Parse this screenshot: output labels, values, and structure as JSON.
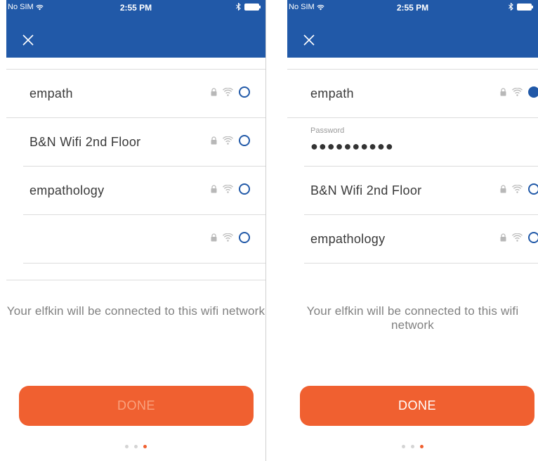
{
  "colors": {
    "header_blue": "#2159a8",
    "accent_orange": "#f06030",
    "divider": "#dcdcdc"
  },
  "left_screen": {
    "statusbar": {
      "carrier": "No SIM",
      "time": "2:55 PM"
    },
    "networks": [
      {
        "name": "empath",
        "secured": true,
        "selected": false
      },
      {
        "name": "B&N Wifi 2nd Floor",
        "secured": true,
        "selected": false
      },
      {
        "name": "empathology",
        "secured": true,
        "selected": false
      },
      {
        "name": "",
        "secured": true,
        "selected": false
      }
    ],
    "message": "Your elfkin will be connected to this wifi network",
    "done_label": "DONE",
    "done_enabled": false,
    "page_indicator": {
      "pages": 3,
      "current": 3
    }
  },
  "right_screen": {
    "statusbar": {
      "carrier": "No SIM",
      "time": "2:55 PM"
    },
    "networks": [
      {
        "name": "empath",
        "secured": true,
        "selected": true
      },
      {
        "name": "B&N Wifi 2nd Floor",
        "secured": true,
        "selected": false
      },
      {
        "name": "empathology",
        "secured": true,
        "selected": false
      }
    ],
    "password": {
      "label": "Password",
      "value": "●●●●●●●●●●"
    },
    "message": "Your elfkin will be connected to this wifi network",
    "done_label": "DONE",
    "done_enabled": true,
    "page_indicator": {
      "pages": 3,
      "current": 3
    }
  }
}
